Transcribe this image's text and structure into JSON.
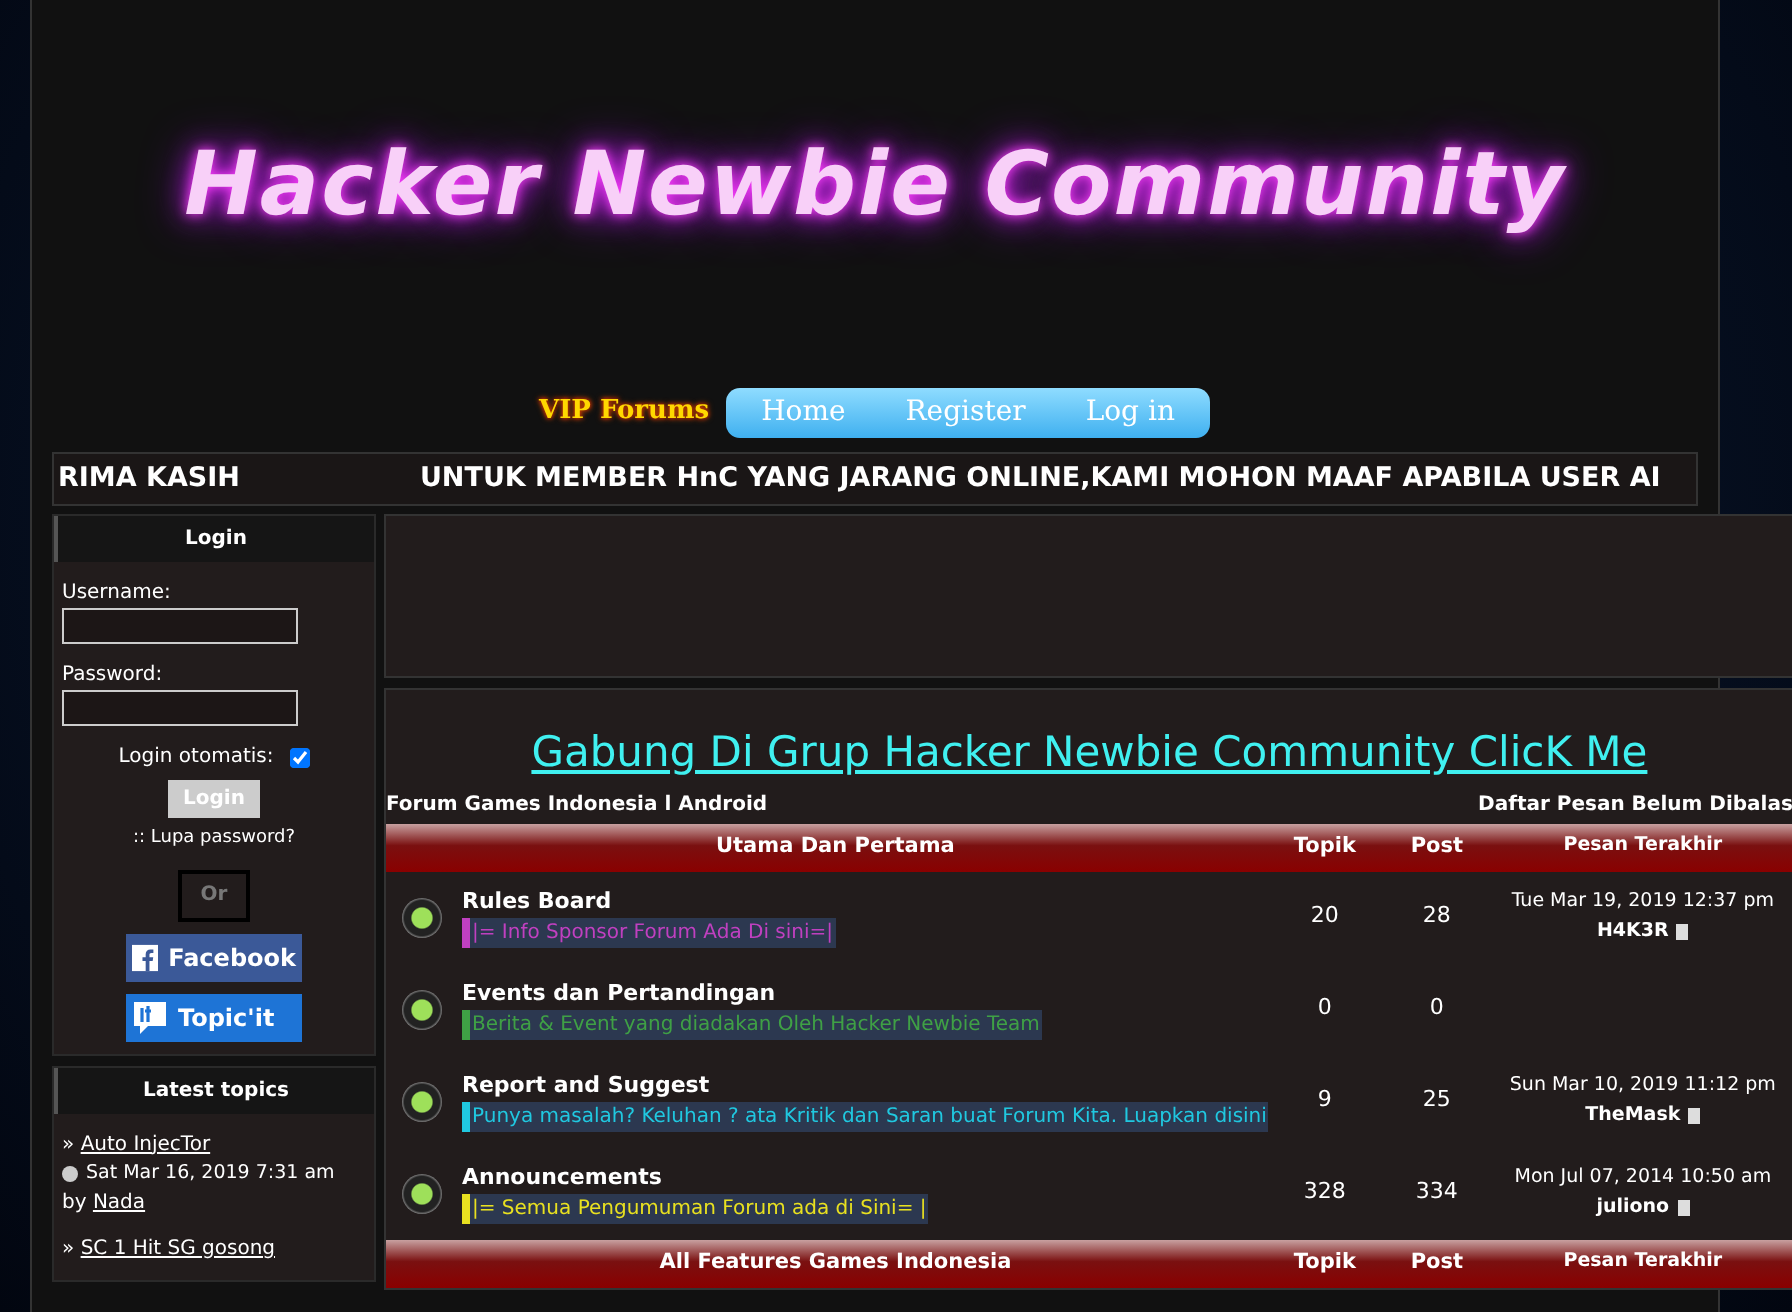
{
  "header": {
    "title": "Hacker Newbie Community"
  },
  "nav": {
    "vip": "VIP Forums",
    "links": [
      "Home",
      "Register",
      "Log in"
    ]
  },
  "marquee": [
    "RIMA KASIH",
    "UNTUK MEMBER HnC YANG JARANG ONLINE,KAMI MOHON MAAF APABILA USER AI"
  ],
  "login": {
    "title": "Login",
    "username_label": "Username:",
    "password_label": "Password:",
    "remember_label": "Login otomatis:",
    "remember_checked": true,
    "button": "Login",
    "forgot": ":: Lupa password?",
    "or": "Or",
    "social": [
      {
        "kind": "facebook",
        "label": "Facebook"
      },
      {
        "kind": "topicit",
        "label": "Topic'it"
      }
    ]
  },
  "latest_topics": {
    "title": "Latest topics",
    "items": [
      {
        "bullet": "»",
        "title": "Auto InjecTor",
        "date": "Sat Mar 16, 2019 7:31 am",
        "by": "by",
        "author": "Nada"
      },
      {
        "bullet": "»",
        "title": "SC 1 Hit SG gosong"
      }
    ]
  },
  "banner_link": "Gabung Di Grup Hacker Newbie Community ClicK Me",
  "breadcrumb": "Forum Games Indonesia l Android",
  "unanswered": "Daftar Pesan Belum Dibalas",
  "categories": [
    {
      "title": "Utama Dan Pertama",
      "columns": [
        "Topik",
        "Post",
        "Pesan Terakhir"
      ],
      "forums": [
        {
          "name": "Rules Board",
          "description": "|= Info Sponsor Forum Ada Di sini=|",
          "color": "#c040c0",
          "topics": "20",
          "posts": "28",
          "last_date": "Tue Mar 19, 2019 12:37 pm",
          "last_user": "H4K3R"
        },
        {
          "name": "Events dan Pertandingan",
          "description": "Berita & Event yang diadakan Oleh Hacker Newbie Team",
          "color": "#3fa045",
          "topics": "0",
          "posts": "0"
        },
        {
          "name": "Report and Suggest",
          "description": "Punya masalah? Keluhan ? ata Kritik dan Saran buat Forum Kita. Luapkan disini",
          "color": "#20c8e0",
          "topics": "9",
          "posts": "25",
          "last_date": "Sun Mar 10, 2019 11:12 pm",
          "last_user": "TheMask"
        },
        {
          "name": "Announcements",
          "description": "|= Semua Pengumuman Forum ada di Sini= |",
          "color": "#e8e020",
          "topics": "328",
          "posts": "334",
          "last_date": "Mon Jul 07, 2014 10:50 am",
          "last_user": "juliono"
        }
      ]
    },
    {
      "title": "All Features Games Indonesia",
      "columns": [
        "Topik",
        "Post",
        "Pesan Terakhir"
      ]
    }
  ]
}
